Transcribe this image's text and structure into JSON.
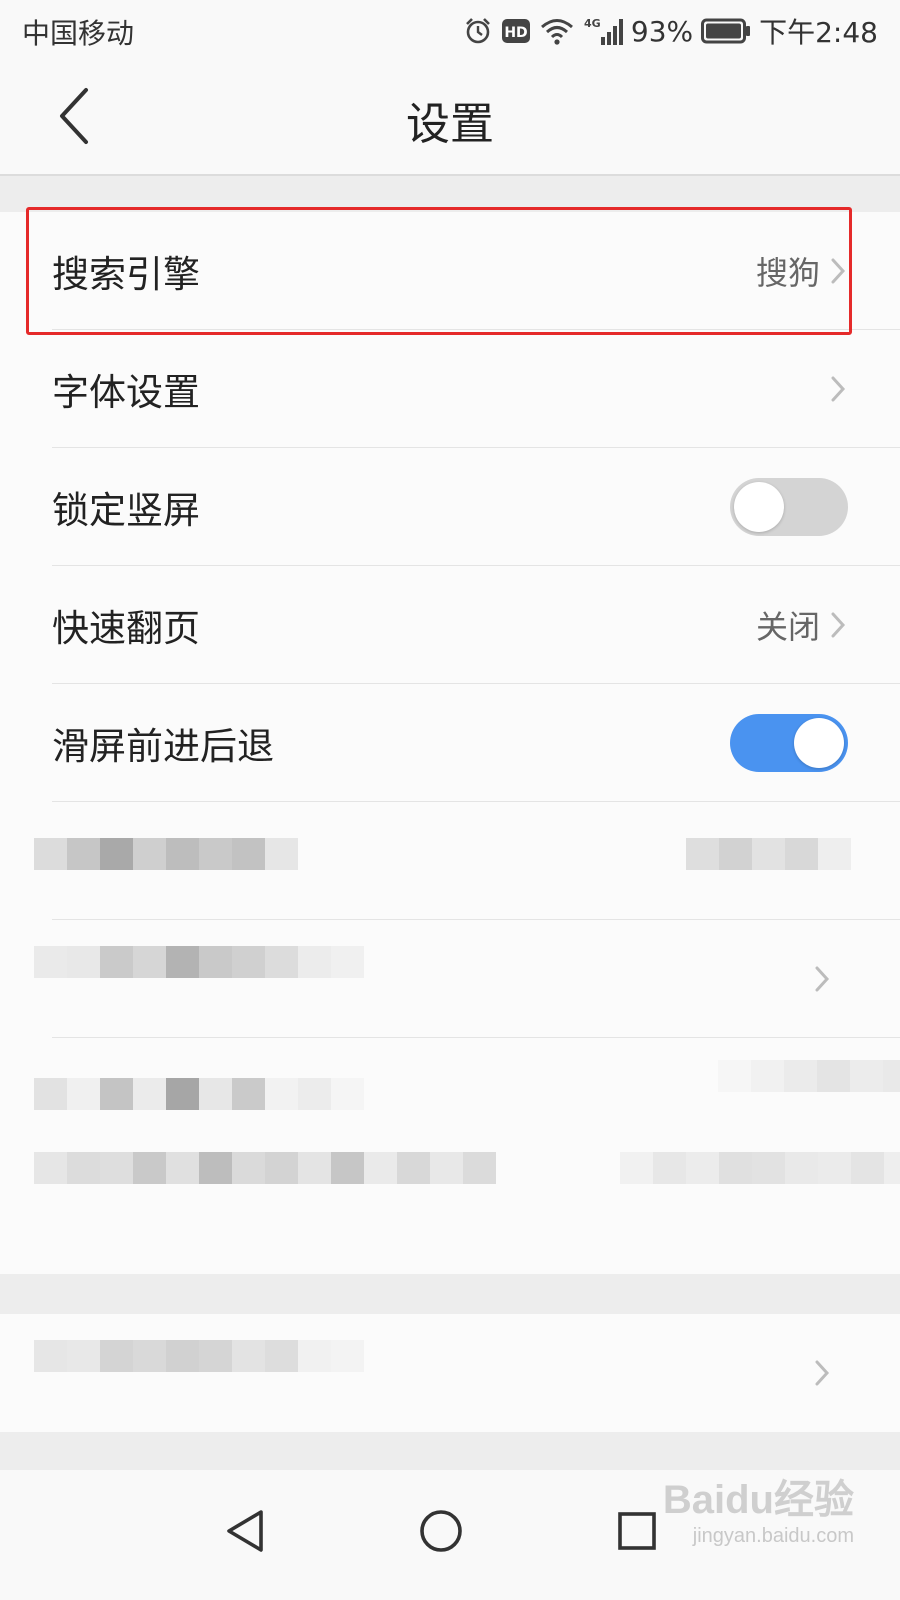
{
  "status_bar": {
    "carrier": "中国移动",
    "battery": "93%",
    "time": "下午2:48",
    "icons": [
      "alarm-icon",
      "hd-icon",
      "wifi-icon",
      "4g-signal-icon",
      "battery-icon"
    ]
  },
  "header": {
    "title": "设置",
    "back_icon": "chevron-left-icon"
  },
  "settings": [
    {
      "label": "搜索引擎",
      "value": "搜狗",
      "type": "link",
      "highlighted": true
    },
    {
      "label": "字体设置",
      "value": "",
      "type": "link"
    },
    {
      "label": "锁定竖屏",
      "type": "toggle",
      "on": false
    },
    {
      "label": "快速翻页",
      "value": "关闭",
      "type": "link"
    },
    {
      "label": "滑屏前进后退",
      "type": "toggle",
      "on": true
    }
  ],
  "colors": {
    "highlight": "#e52a2a",
    "toggle_on": "#4a93f0",
    "toggle_off": "#d4d4d4"
  },
  "nav_bar": {
    "icons": [
      "back-triangle-icon",
      "home-circle-icon",
      "recents-square-icon"
    ]
  },
  "watermark": {
    "main": "Baidu经验",
    "sub": "jingyan.baidu.com"
  }
}
